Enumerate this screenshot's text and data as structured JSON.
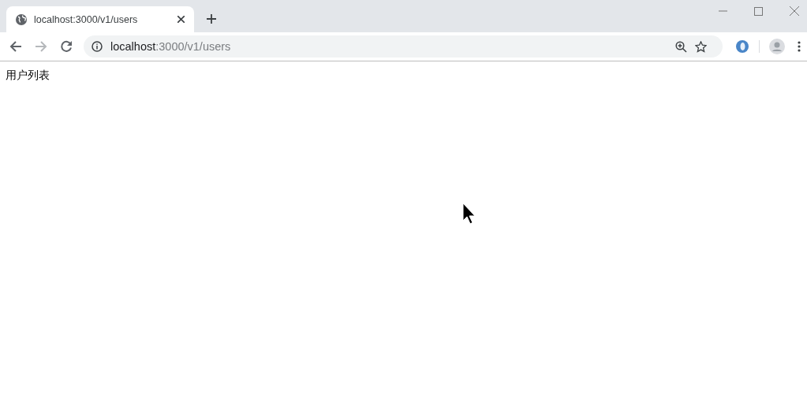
{
  "tabs": [
    {
      "title": "localhost:3000/v1/users",
      "selected": true
    }
  ],
  "toolbar": {
    "back_disabled": false,
    "forward_disabled": true
  },
  "address_bar": {
    "host": "localhost",
    "path": ":3000/v1/users"
  },
  "page": {
    "heading": "用户列表"
  }
}
